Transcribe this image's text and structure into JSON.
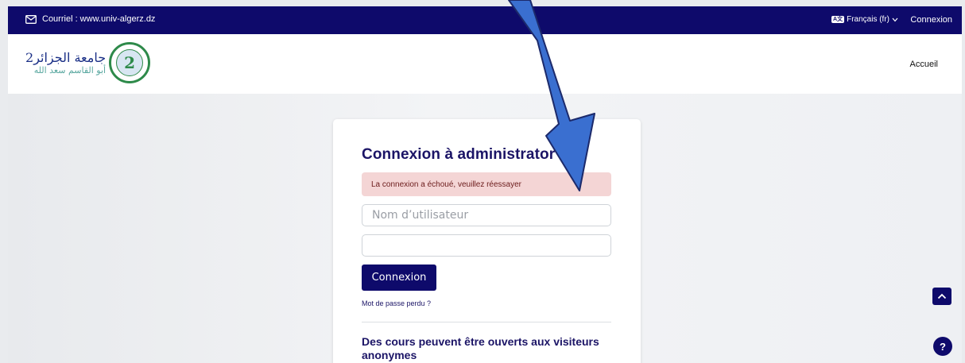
{
  "topbar": {
    "email": "Courriel : www.univ-algerz.dz",
    "language": "Français (fr)",
    "login": "Connexion"
  },
  "header": {
    "logo_arabic_line1": "جامعة الجزائر2",
    "logo_arabic_line2": "أبو القاسم سعد الله",
    "seal_text": "2",
    "nav_home": "Accueil"
  },
  "login": {
    "title": "Connexion à administrator",
    "error": "La connexion a échoué, veuillez réessayer",
    "username_placeholder": "Nom d’utilisateur",
    "password_value": "",
    "submit": "Connexion",
    "forgot": "Mot de passe perdu ?",
    "guest_title": "Des cours peuvent être ouverts aux visiteurs anonymes"
  },
  "floating": {
    "help": "?"
  },
  "colors": {
    "brand": "#0e0a6b",
    "alert_bg": "#f4d5d5",
    "arrow": "#3a6fd0"
  }
}
